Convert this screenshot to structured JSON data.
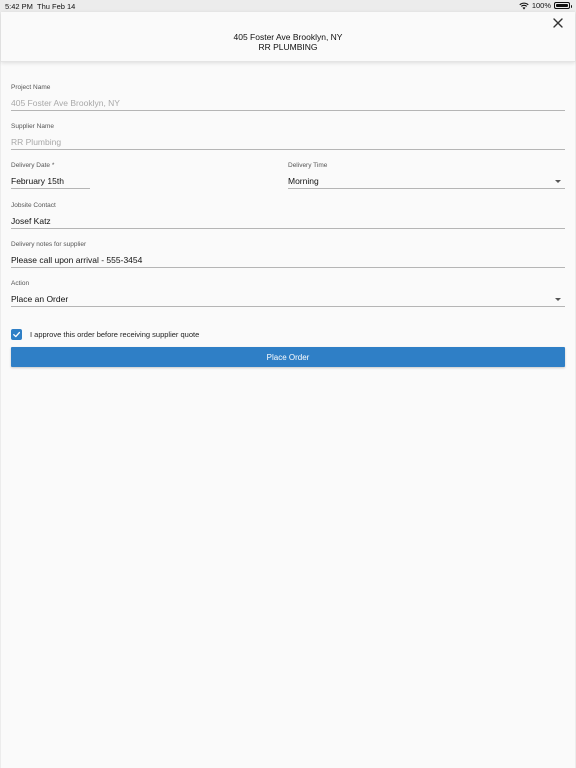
{
  "status_bar": {
    "time": "5:42 PM",
    "date": "Thu Feb 14",
    "battery": "100%"
  },
  "header": {
    "address": "405 Foster Ave Brooklyn, NY",
    "supplier": "RR PLUMBING"
  },
  "form": {
    "project_name": {
      "label": "Project Name",
      "value": "405 Foster Ave Brooklyn, NY"
    },
    "supplier_name": {
      "label": "Supplier Name",
      "value": "RR Plumbing"
    },
    "delivery_date": {
      "label": "Delivery Date *",
      "value": "February 15th"
    },
    "delivery_time": {
      "label": "Delivery Time",
      "value": "Morning"
    },
    "jobsite_contact": {
      "label": "Jobsite Contact",
      "value": "Josef Katz"
    },
    "delivery_notes": {
      "label": "Delivery notes for supplier",
      "value": "Please call upon arrival - 555-3454"
    },
    "action": {
      "label": "Action",
      "value": "Place an Order"
    },
    "approve": {
      "label": "I approve this order before receiving supplier quote",
      "checked": true
    }
  },
  "place_order_label": "Place Order",
  "colors": {
    "accent": "#2f7fc6",
    "sheet_bg": "#fafafa",
    "backdrop": "#ececec"
  }
}
